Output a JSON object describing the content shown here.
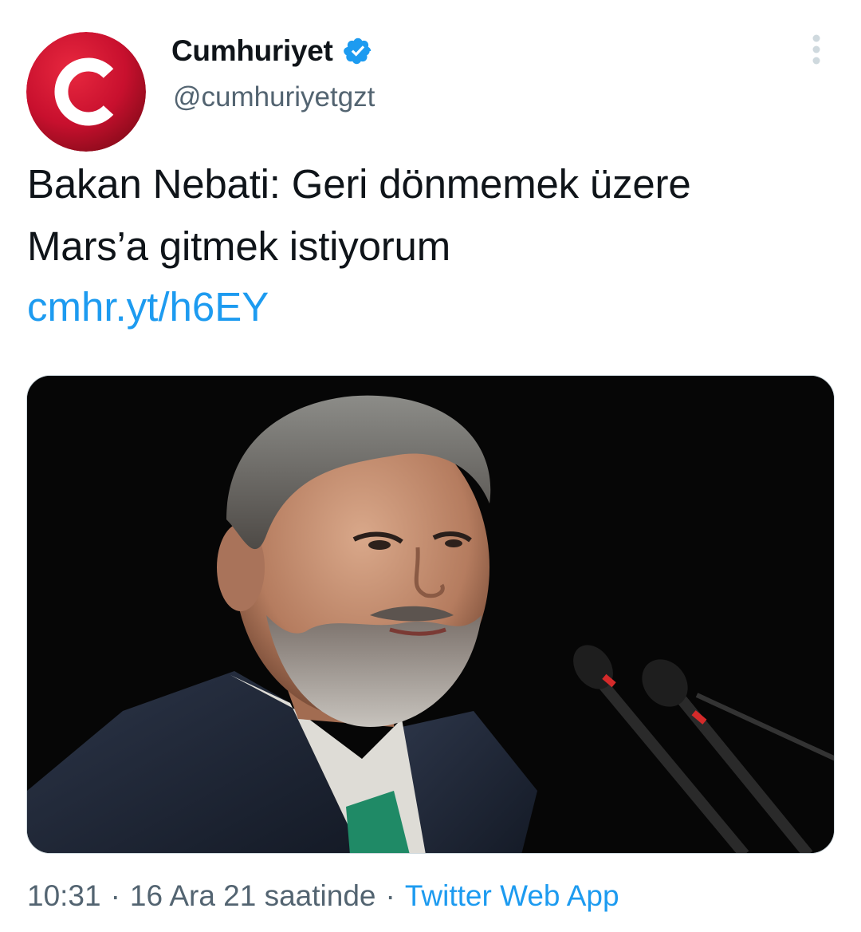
{
  "account": {
    "display_name": "Cumhuriyet",
    "handle": "@cumhuriyetgzt",
    "verified": true,
    "avatar_icon": "cumhuriyet-logo-icon",
    "avatar_colors": {
      "primary": "#c8102e",
      "dark": "#7a0a18",
      "letter": "#ffffff"
    }
  },
  "tweet": {
    "text_lines": [
      "Bakan Nebati: Geri dönmemek üzere",
      "Mars’a gitmek istiyorum"
    ],
    "link": "cmhr.yt/h6EY",
    "media_description_icon": "photo-of-speaker-at-microphone",
    "meta": {
      "time": "10:31",
      "separator": "·",
      "date": "16 Ara 21 saatinde",
      "source": "Twitter Web App"
    }
  },
  "colors": {
    "text": "#0f1419",
    "secondary": "#536471",
    "link": "#1d9bf0",
    "verified_badge": "#1d9bf0"
  }
}
